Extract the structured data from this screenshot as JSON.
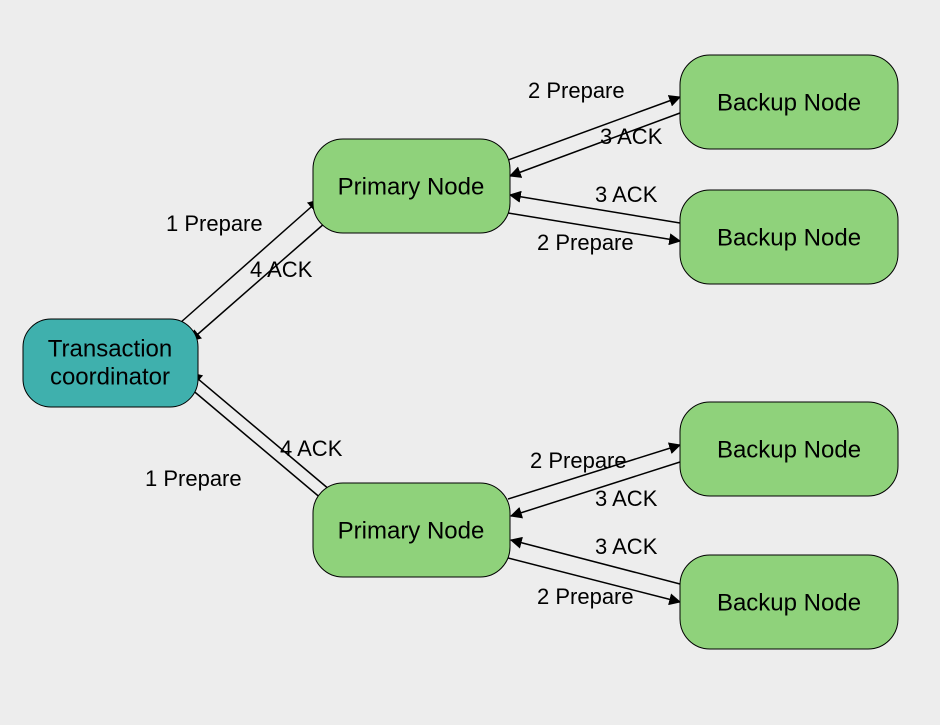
{
  "nodes": {
    "coordinator": {
      "line1": "Transaction",
      "line2": "coordinator"
    },
    "primary1": "Primary Node",
    "primary2": "Primary Node",
    "backup1": "Backup Node",
    "backup2": "Backup Node",
    "backup3": "Backup Node",
    "backup4": "Backup Node"
  },
  "edges": {
    "tc_p1_prepare": "1 Prepare",
    "p1_tc_ack": "4 ACK",
    "tc_p2_prepare": "1 Prepare",
    "p2_tc_ack": "4 ACK",
    "p1_b1_prepare": "2 Prepare",
    "b1_p1_ack": "3 ACK",
    "p1_b2_prepare": "2 Prepare",
    "b2_p1_ack": "3 ACK",
    "p2_b3_prepare": "2 Prepare",
    "b3_p2_ack": "3 ACK",
    "p2_b4_prepare": "2 Prepare",
    "b4_p2_ack": "3 ACK"
  }
}
